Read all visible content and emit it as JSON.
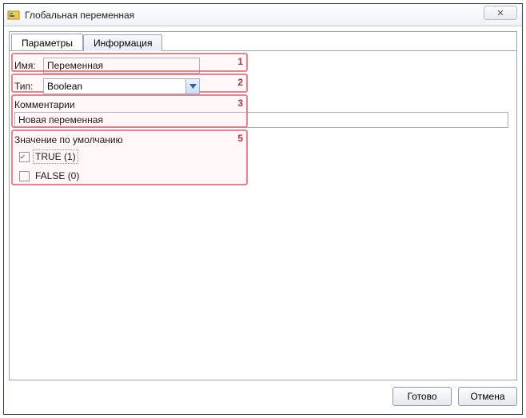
{
  "window": {
    "title": "Глобальная переменная",
    "close_glyph": "✕"
  },
  "tabs": {
    "parameters": "Параметры",
    "info": "Информация"
  },
  "fields": {
    "name_label": "Имя:",
    "name_value": "Переменная",
    "type_label": "Тип:",
    "type_value": "Boolean",
    "comments_label": "Комментарии",
    "comments_value": "Новая переменная",
    "default_label": "Значение по умолчанию",
    "true_label": "TRUE (1)",
    "false_label": "FALSE (0)",
    "true_checked": true,
    "false_checked": false
  },
  "annotations": {
    "n1": "1",
    "n2": "2",
    "n3": "3",
    "n5": "5"
  },
  "buttons": {
    "ok": "Готово",
    "cancel": "Отмена"
  }
}
